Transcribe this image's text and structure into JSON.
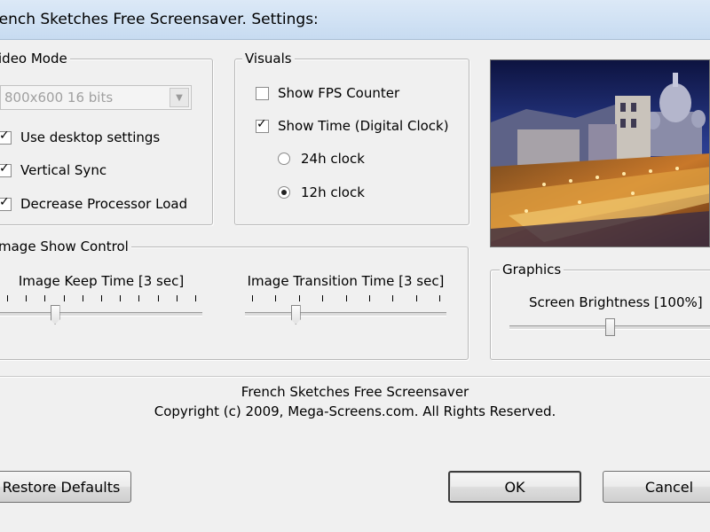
{
  "window": {
    "title": "rench Sketches Free Screensaver. Settings:"
  },
  "video_mode": {
    "title": "ideo Mode",
    "resolution_value": "800x600 16 bits",
    "use_desktop_settings": {
      "label": "Use desktop settings",
      "checked": true
    },
    "vertical_sync": {
      "label": "Vertical Sync",
      "checked": true
    },
    "decrease_processor_load": {
      "label": "Decrease Processor Load",
      "checked": true
    }
  },
  "visuals": {
    "title": "Visuals",
    "show_fps_counter": {
      "label": "Show FPS Counter",
      "checked": false
    },
    "show_time": {
      "label": "Show Time (Digital Clock)",
      "checked": true
    },
    "clock_24h": {
      "label": "24h clock",
      "selected": false
    },
    "clock_12h": {
      "label": "12h clock",
      "selected": true
    }
  },
  "image_show_control": {
    "title": "mage Show Control",
    "keep_time": {
      "label": "Image Keep Time [3 sec]",
      "value_fraction": 0.27
    },
    "transition_time": {
      "label": "Image Transition Time [3 sec]",
      "value_fraction": 0.25
    }
  },
  "graphics": {
    "title": "Graphics",
    "brightness": {
      "label": "Screen Brightness [100%]",
      "value_fraction": 0.5
    }
  },
  "footer": {
    "product_name": "French Sketches Free Screensaver",
    "copyright": "Copyright (c) 2009, Mega-Screens.com. All Rights Reserved."
  },
  "buttons": {
    "restore_defaults": "Restore Defaults",
    "ok": "OK",
    "cancel": "Cancel"
  },
  "colors": {
    "title_bar": "#c7dbf1",
    "dialog_bg": "#f0f0f0"
  }
}
